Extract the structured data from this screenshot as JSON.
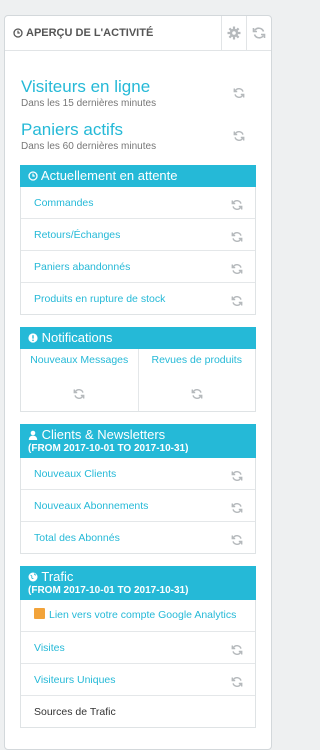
{
  "colors": {
    "accent": "#25b9d7",
    "icon_grey": "#b5b9bc"
  },
  "header": {
    "title": "APERÇU DE L'ACTIVITÉ",
    "title_icon": "clock-icon",
    "buttons": [
      "gear-icon",
      "refresh-icon"
    ]
  },
  "stats": [
    {
      "title": "Visiteurs en ligne",
      "sub": "Dans les 15 dernières minutes"
    },
    {
      "title": "Paniers actifs",
      "sub": "Dans les 60 dernières minutes"
    }
  ],
  "pending": {
    "title": "Actuellement en attente",
    "icon": "clock-icon",
    "rows": [
      "Commandes",
      "Retours/Échanges",
      "Paniers abandonnés",
      "Produits en rupture de stock"
    ]
  },
  "notifications": {
    "title": "Notifications",
    "icon": "exclamation-icon",
    "cells": [
      "Nouveaux Messages",
      "Revues de produits"
    ]
  },
  "clients": {
    "title": "Clients & Newsletters",
    "sub": "(FROM 2017-10-01 TO 2017-10-31)",
    "icon": "user-icon",
    "rows": [
      "Nouveaux Clients",
      "Nouveaux Abonnements",
      "Total des Abonnés"
    ]
  },
  "traffic": {
    "title": "Trafic",
    "sub": "(FROM 2017-10-01 TO 2017-10-31)",
    "icon": "globe-icon",
    "ga_link": "Lien vers votre compte Google Analytics",
    "rows": [
      "Visites",
      "Visiteurs Uniques"
    ],
    "sources": "Sources de Trafic"
  }
}
